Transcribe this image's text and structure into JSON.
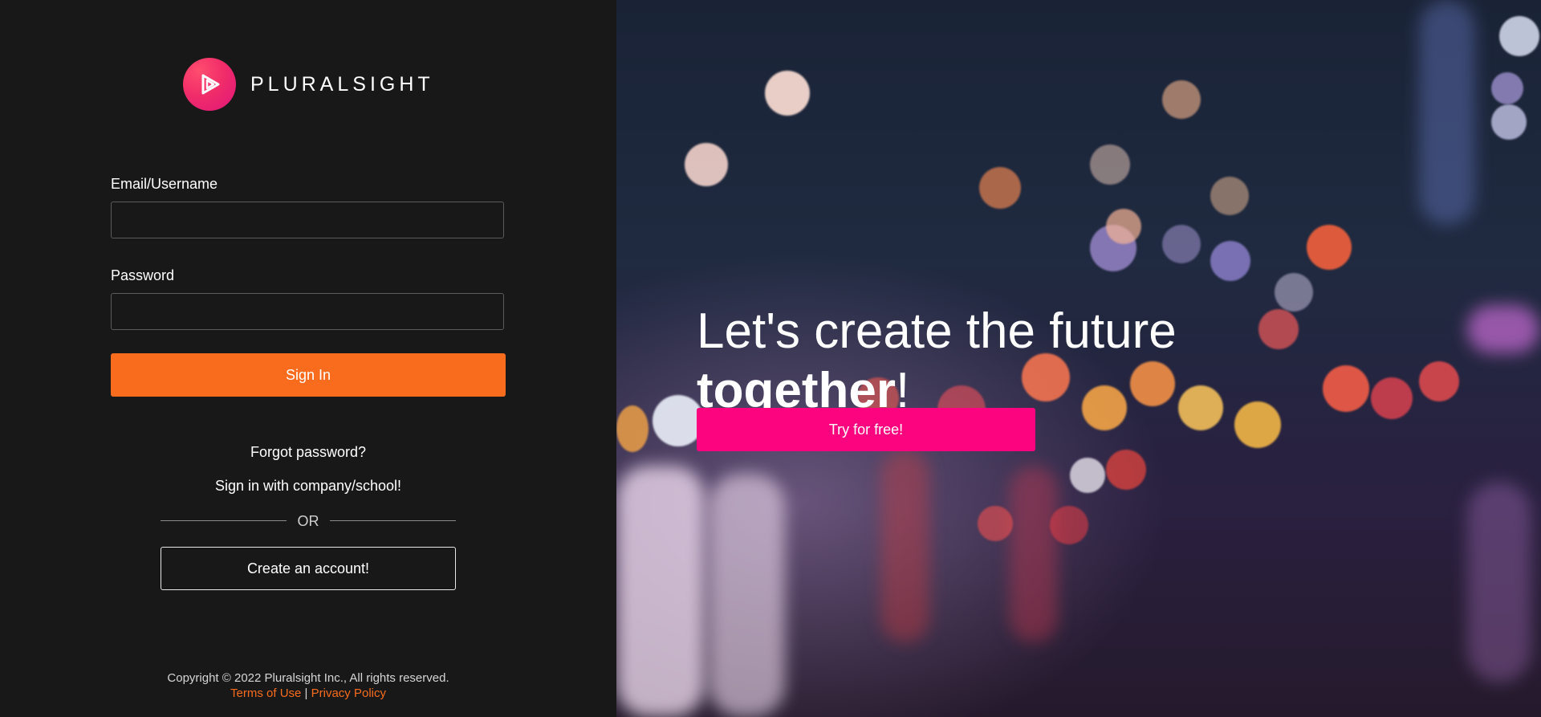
{
  "brand": {
    "name": "PLURALSIGHT",
    "logo_icon": "play-triangle-icon",
    "logo_color": "#f12d69"
  },
  "form": {
    "email_label": "Email/Username",
    "email_value": "",
    "password_label": "Password",
    "password_value": "",
    "signin_label": "Sign In",
    "forgot_label": "Forgot password?",
    "sso_label": "Sign in with company/school!",
    "or_label": "OR",
    "create_label": "Create an account!"
  },
  "footer": {
    "copyright": "Copyright © 2022 Pluralsight Inc., All rights reserved.",
    "terms": "Terms of Use",
    "separator": "|",
    "privacy": "Privacy Policy"
  },
  "hero": {
    "line1": "Let's create the future",
    "line2_strong": "together",
    "line2_punct": "!",
    "cta": "Try for free!"
  },
  "colors": {
    "accent_orange": "#f96c1d",
    "accent_pink": "#fc0480",
    "panel_bg": "#181818"
  }
}
